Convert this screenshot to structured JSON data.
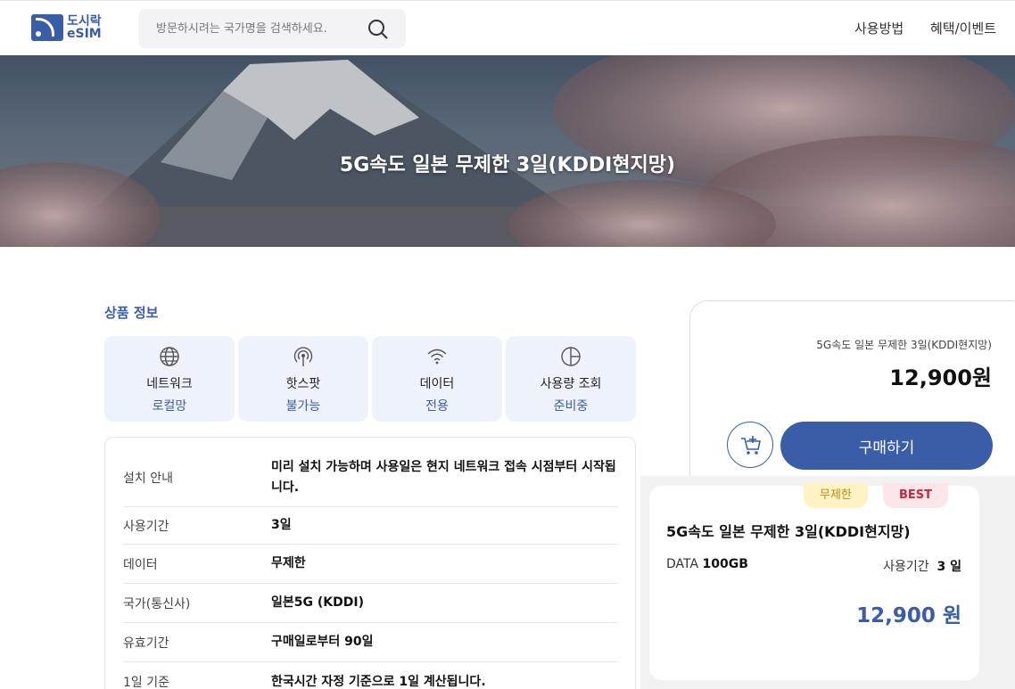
{
  "header": {
    "logo_line1": "도시락",
    "logo_line2": "eSIM",
    "search_placeholder": "방문하시려는 국가명을 검색하세요.",
    "nav": [
      "사용방법",
      "혜택/이벤트"
    ]
  },
  "banner": {
    "title": "5G속도 일본 무제한 3일(KDDI현지망)"
  },
  "product_info": {
    "section_title": "상품 정보",
    "features": [
      {
        "label": "네트워크",
        "value": "로컬망",
        "icon": "globe-icon"
      },
      {
        "label": "핫스팟",
        "value": "불가능",
        "icon": "hotspot-icon"
      },
      {
        "label": "데이터",
        "value": "전용",
        "icon": "wifi-icon"
      },
      {
        "label": "사용량 조회",
        "value": "준비중",
        "icon": "pie-chart-icon"
      }
    ],
    "rows": [
      {
        "key": "설치 안내",
        "value": "미리 설치 가능하며 사용일은 현지 네트워크 접속 시점부터 시작됩니다."
      },
      {
        "key": "사용기간",
        "value": "3일"
      },
      {
        "key": "데이터",
        "value": "무제한"
      },
      {
        "key": "국가(통신사)",
        "value": "일본5G (KDDI)"
      },
      {
        "key": "유효기간",
        "value": "구매일로부터 90일"
      },
      {
        "key": "1일 기준",
        "value": "한국시간 자정 기준으로 1일 계산됩니다."
      }
    ]
  },
  "purchase": {
    "product_name": "5G속도 일본 무제한 3일(KDDI현지망)",
    "price": "12,900원",
    "cart_icon": "cart-plus-icon",
    "buy_label": "구매하기"
  },
  "product_card": {
    "tag_unlimited": "무제한",
    "tag_best": "BEST",
    "title": "5G속도 일본 무제한 3일(KDDI현지망)",
    "data_label": "DATA",
    "data_value": "100GB",
    "period_label": "사용기간",
    "period_value": "3 일",
    "price": "12,900 원"
  },
  "colors": {
    "brand": "#3a5da8",
    "feature_bg": "#eef2fb",
    "tag_unlimited_bg": "#fff3c4",
    "tag_best_bg": "#fde6ea"
  }
}
